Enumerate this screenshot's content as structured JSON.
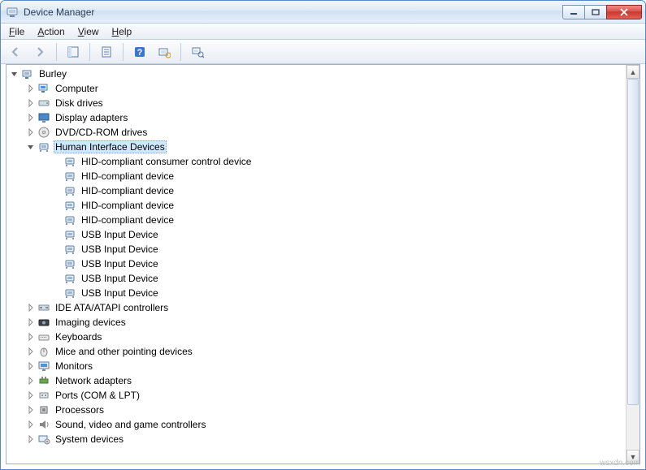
{
  "window": {
    "title": "Device Manager"
  },
  "menus": {
    "file": "File",
    "action": "Action",
    "view": "View",
    "help": "Help"
  },
  "toolbar": {
    "back": "back-arrow",
    "forward": "forward-arrow",
    "show_hide": "show-hide-tree",
    "properties": "properties",
    "help": "help",
    "scan": "scan-hardware",
    "view_mode": "view-mode"
  },
  "tree": {
    "root": {
      "label": "Burley",
      "expanded": true
    },
    "categories": [
      {
        "label": "Computer",
        "icon": "computer",
        "expanded": false
      },
      {
        "label": "Disk drives",
        "icon": "disk",
        "expanded": false
      },
      {
        "label": "Display adapters",
        "icon": "display",
        "expanded": false
      },
      {
        "label": "DVD/CD-ROM drives",
        "icon": "dvd",
        "expanded": false
      },
      {
        "label": "Human Interface Devices",
        "icon": "hid",
        "expanded": true,
        "selected": true,
        "children": [
          {
            "label": "HID-compliant consumer control device",
            "icon": "hid"
          },
          {
            "label": "HID-compliant device",
            "icon": "hid"
          },
          {
            "label": "HID-compliant device",
            "icon": "hid"
          },
          {
            "label": "HID-compliant device",
            "icon": "hid"
          },
          {
            "label": "HID-compliant device",
            "icon": "hid"
          },
          {
            "label": "USB Input Device",
            "icon": "hid"
          },
          {
            "label": "USB Input Device",
            "icon": "hid"
          },
          {
            "label": "USB Input Device",
            "icon": "hid"
          },
          {
            "label": "USB Input Device",
            "icon": "hid"
          },
          {
            "label": "USB Input Device",
            "icon": "hid"
          }
        ]
      },
      {
        "label": "IDE ATA/ATAPI controllers",
        "icon": "ide",
        "expanded": false
      },
      {
        "label": "Imaging devices",
        "icon": "imaging",
        "expanded": false
      },
      {
        "label": "Keyboards",
        "icon": "keyboard",
        "expanded": false
      },
      {
        "label": "Mice and other pointing devices",
        "icon": "mouse",
        "expanded": false
      },
      {
        "label": "Monitors",
        "icon": "monitor",
        "expanded": false
      },
      {
        "label": "Network adapters",
        "icon": "network",
        "expanded": false
      },
      {
        "label": "Ports (COM & LPT)",
        "icon": "ports",
        "expanded": false
      },
      {
        "label": "Processors",
        "icon": "processor",
        "expanded": false
      },
      {
        "label": "Sound, video and game controllers",
        "icon": "sound",
        "expanded": false
      },
      {
        "label": "System devices",
        "icon": "system",
        "expanded": false
      }
    ]
  },
  "watermark": "wsxdn.com"
}
